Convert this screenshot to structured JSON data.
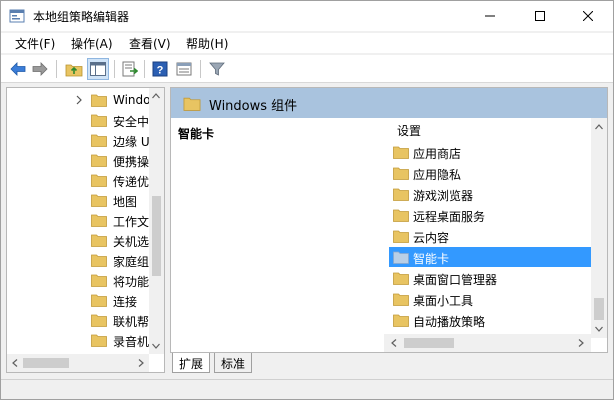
{
  "window": {
    "title": "本地组策略编辑器"
  },
  "menubar": {
    "items": [
      {
        "label": "文件(F)"
      },
      {
        "label": "操作(A)"
      },
      {
        "label": "查看(V)"
      },
      {
        "label": "帮助(H)"
      }
    ]
  },
  "toolbar": {
    "icons": [
      "back-arrow-icon",
      "forward-arrow-icon",
      "up-folder-icon",
      "show-hide-tree-icon",
      "export-list-icon",
      "help-icon",
      "properties-icon",
      "filter-icon"
    ]
  },
  "tree": {
    "items": [
      {
        "label": "Windo",
        "expandable": true
      },
      {
        "label": "安全中"
      },
      {
        "label": "边缘 U"
      },
      {
        "label": "便携操"
      },
      {
        "label": "传递优"
      },
      {
        "label": "地图"
      },
      {
        "label": "工作文"
      },
      {
        "label": "关机选"
      },
      {
        "label": "家庭组"
      },
      {
        "label": "将功能"
      },
      {
        "label": "连接"
      },
      {
        "label": "联机帮"
      },
      {
        "label": "录音机"
      }
    ]
  },
  "right_pane": {
    "header_title": "Windows 组件",
    "description_title": "智能卡",
    "column_header": "设置",
    "items": [
      {
        "label": "应用商店",
        "selected": false
      },
      {
        "label": "应用隐私",
        "selected": false
      },
      {
        "label": "游戏浏览器",
        "selected": false
      },
      {
        "label": "远程桌面服务",
        "selected": false
      },
      {
        "label": "云内容",
        "selected": false
      },
      {
        "label": "智能卡",
        "selected": true
      },
      {
        "label": "桌面窗口管理器",
        "selected": false
      },
      {
        "label": "桌面小工具",
        "selected": false
      },
      {
        "label": "自动播放策略",
        "selected": false
      }
    ]
  },
  "tabs": [
    {
      "label": "扩展",
      "active": true
    },
    {
      "label": "标准",
      "active": false
    }
  ],
  "colors": {
    "header_bg": "#a9c3de",
    "selection": "#3399ff",
    "folder": "#e8c462"
  }
}
